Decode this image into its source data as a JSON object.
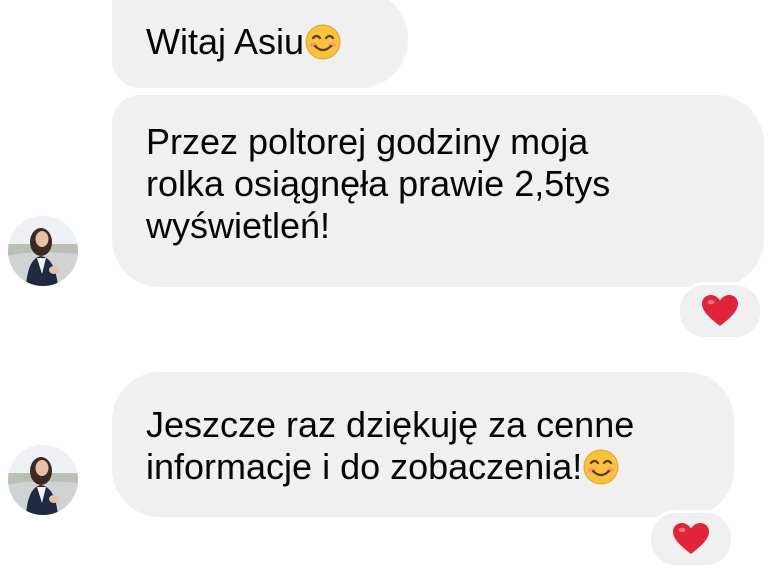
{
  "messages": [
    {
      "lines": [
        "Witaj Asiu"
      ],
      "trailing_emoji": "smiling-face-icon"
    },
    {
      "lines": [
        "Przez poltorej godziny moja",
        "rolka osiągnęła prawie 2,5tys",
        "wyświetleń!"
      ],
      "reaction": "heart-icon"
    },
    {
      "lines": [
        "Jeszcze raz dziękuję za cenne",
        "informacje i do zobaczenia!"
      ],
      "trailing_emoji": "smiling-face-icon",
      "reaction": "heart-icon"
    }
  ],
  "colors": {
    "bubble": "#f0f0f0",
    "text": "#050505",
    "heart": "#e0243a",
    "emoji_face": "#f9c23c"
  }
}
